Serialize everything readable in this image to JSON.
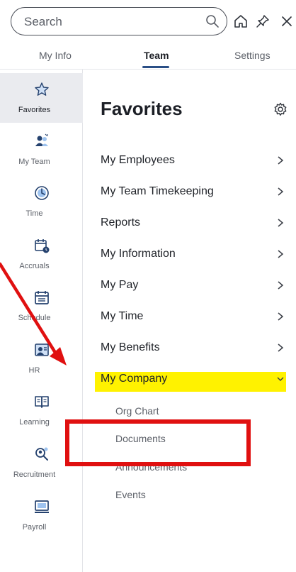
{
  "search": {
    "placeholder": "Search"
  },
  "tabs": [
    {
      "label": "My Info",
      "active": false
    },
    {
      "label": "Team",
      "active": true
    },
    {
      "label": "Settings",
      "active": false
    }
  ],
  "rail": [
    {
      "label": "Favorites",
      "icon": "star-icon",
      "active": true
    },
    {
      "label": "My Team",
      "icon": "team-icon"
    },
    {
      "label": "Time",
      "icon": "clock-icon"
    },
    {
      "label": "Accruals",
      "icon": "calendar-clock-icon"
    },
    {
      "label": "Schedule",
      "icon": "calendar-icon"
    },
    {
      "label": "HR",
      "icon": "hr-icon"
    },
    {
      "label": "Learning",
      "icon": "book-icon"
    },
    {
      "label": "Recruitment",
      "icon": "recruitment-icon"
    },
    {
      "label": "Payroll",
      "icon": "payroll-icon"
    }
  ],
  "main": {
    "title": "Favorites",
    "items": [
      {
        "label": "My Employees"
      },
      {
        "label": "My Team Timekeeping"
      },
      {
        "label": "Reports"
      },
      {
        "label": "My Information"
      },
      {
        "label": "My Pay"
      },
      {
        "label": "My Time"
      },
      {
        "label": "My Benefits"
      },
      {
        "label": "My Company",
        "expanded": true
      }
    ],
    "subitems": [
      {
        "label": "Org Chart"
      },
      {
        "label": "Documents"
      },
      {
        "label": "Announcements"
      },
      {
        "label": "Events"
      }
    ]
  },
  "colors": {
    "accent": "#2a4f86",
    "highlight": "#fff200",
    "annotation": "#e01010"
  }
}
